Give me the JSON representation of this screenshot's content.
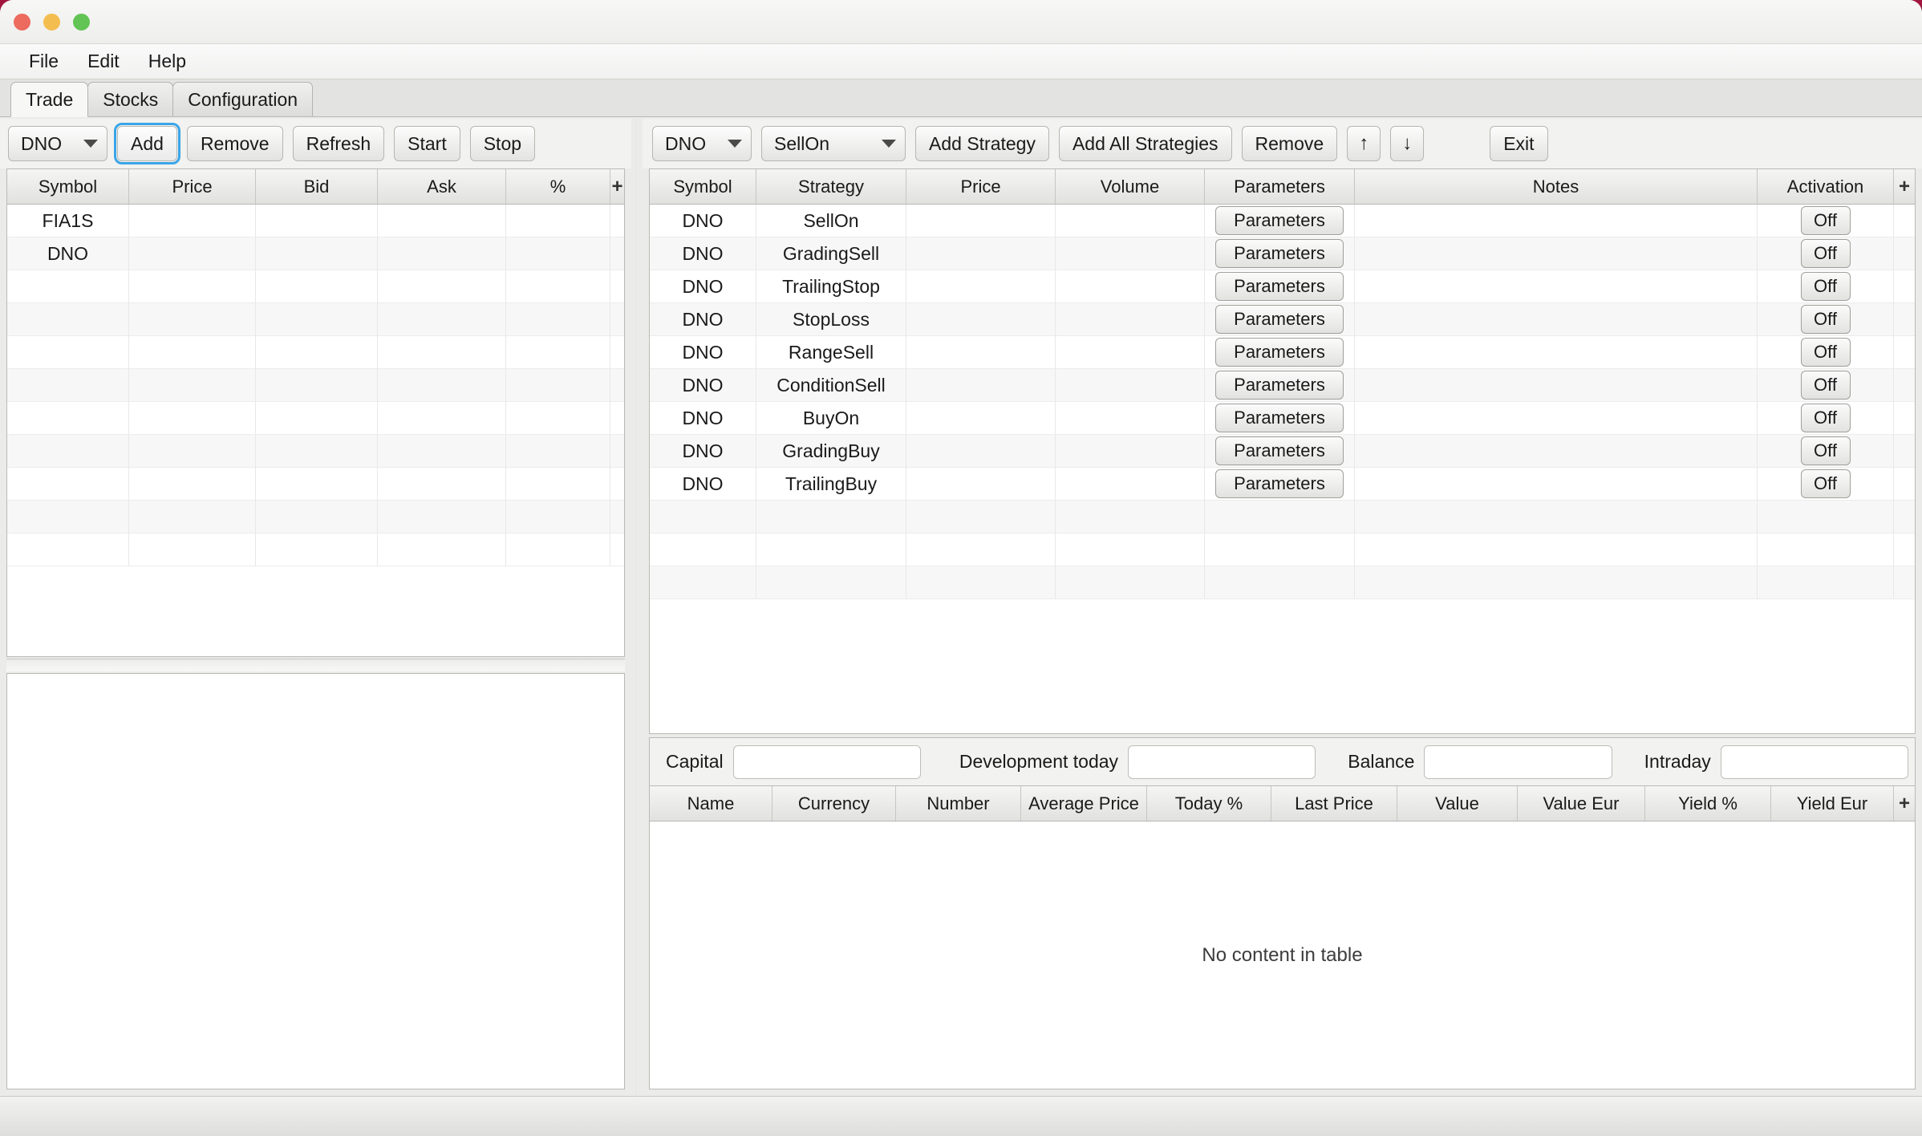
{
  "window": {
    "traffic_lights": [
      "close",
      "minimize",
      "maximize"
    ]
  },
  "menubar": {
    "items": [
      {
        "label": "File"
      },
      {
        "label": "Edit"
      },
      {
        "label": "Help"
      }
    ]
  },
  "tabs": [
    {
      "label": "Trade",
      "active": true
    },
    {
      "label": "Stocks",
      "active": false
    },
    {
      "label": "Configuration",
      "active": false
    }
  ],
  "left_panel": {
    "toolbar": {
      "symbol_combo": {
        "value": "DNO"
      },
      "add_button": {
        "label": "Add",
        "focused": true
      },
      "remove_button": {
        "label": "Remove"
      },
      "refresh_button": {
        "label": "Refresh"
      },
      "start_button": {
        "label": "Start"
      },
      "stop_button": {
        "label": "Stop"
      }
    },
    "table": {
      "columns": [
        "Symbol",
        "Price",
        "Bid",
        "Ask",
        "%",
        "+"
      ],
      "rows": [
        {
          "Symbol": "FIA1S",
          "Price": "",
          "Bid": "",
          "Ask": "",
          "%": ""
        },
        {
          "Symbol": "DNO",
          "Price": "",
          "Bid": "",
          "Ask": "",
          "%": ""
        },
        {
          "Symbol": "",
          "Price": "",
          "Bid": "",
          "Ask": "",
          "%": ""
        },
        {
          "Symbol": "",
          "Price": "",
          "Bid": "",
          "Ask": "",
          "%": ""
        },
        {
          "Symbol": "",
          "Price": "",
          "Bid": "",
          "Ask": "",
          "%": ""
        },
        {
          "Symbol": "",
          "Price": "",
          "Bid": "",
          "Ask": "",
          "%": ""
        },
        {
          "Symbol": "",
          "Price": "",
          "Bid": "",
          "Ask": "",
          "%": ""
        },
        {
          "Symbol": "",
          "Price": "",
          "Bid": "",
          "Ask": "",
          "%": ""
        },
        {
          "Symbol": "",
          "Price": "",
          "Bid": "",
          "Ask": "",
          "%": ""
        },
        {
          "Symbol": "",
          "Price": "",
          "Bid": "",
          "Ask": "",
          "%": ""
        },
        {
          "Symbol": "",
          "Price": "",
          "Bid": "",
          "Ask": "",
          "%": ""
        }
      ]
    },
    "log_pane": {
      "content": ""
    }
  },
  "right_panel": {
    "toolbar": {
      "symbol_combo": {
        "value": "DNO"
      },
      "strategy_combo": {
        "value": "SellOn"
      },
      "add_strategy_button": {
        "label": "Add Strategy"
      },
      "add_all_strategies_button": {
        "label": "Add All Strategies"
      },
      "remove_button": {
        "label": "Remove"
      },
      "move_up_button": {
        "label": "↑"
      },
      "move_down_button": {
        "label": "↓"
      },
      "exit_button": {
        "label": "Exit"
      }
    },
    "strategy_table": {
      "columns": [
        "Symbol",
        "Strategy",
        "Price",
        "Volume",
        "Parameters",
        "Notes",
        "Activation",
        "+"
      ],
      "parameters_button_label": "Parameters",
      "activation_button_label": "Off",
      "rows": [
        {
          "symbol": "DNO",
          "strategy": "SellOn",
          "price": "",
          "volume": "",
          "notes": "",
          "activation": "Off"
        },
        {
          "symbol": "DNO",
          "strategy": "GradingSell",
          "price": "",
          "volume": "",
          "notes": "",
          "activation": "Off"
        },
        {
          "symbol": "DNO",
          "strategy": "TrailingStop",
          "price": "",
          "volume": "",
          "notes": "",
          "activation": "Off"
        },
        {
          "symbol": "DNO",
          "strategy": "StopLoss",
          "price": "",
          "volume": "",
          "notes": "",
          "activation": "Off"
        },
        {
          "symbol": "DNO",
          "strategy": "RangeSell",
          "price": "",
          "volume": "",
          "notes": "",
          "activation": "Off"
        },
        {
          "symbol": "DNO",
          "strategy": "ConditionSell",
          "price": "",
          "volume": "",
          "notes": "",
          "activation": "Off"
        },
        {
          "symbol": "DNO",
          "strategy": "BuyOn",
          "price": "",
          "volume": "",
          "notes": "",
          "activation": "Off"
        },
        {
          "symbol": "DNO",
          "strategy": "GradingBuy",
          "price": "",
          "volume": "",
          "notes": "",
          "activation": "Off"
        },
        {
          "symbol": "DNO",
          "strategy": "TrailingBuy",
          "price": "",
          "volume": "",
          "notes": "",
          "activation": "Off"
        }
      ],
      "empty_rows": 3
    },
    "summary": {
      "capital": {
        "label": "Capital",
        "value": ""
      },
      "development_today": {
        "label": "Development today",
        "value": ""
      },
      "balance": {
        "label": "Balance",
        "value": ""
      },
      "intraday": {
        "label": "Intraday",
        "value": ""
      }
    },
    "portfolio_table": {
      "columns": [
        "Name",
        "Currency",
        "Number",
        "Average Price",
        "Today %",
        "Last Price",
        "Value",
        "Value Eur",
        "Yield %",
        "Yield Eur",
        "+"
      ],
      "empty_message": "No content in table"
    }
  },
  "colors": {
    "focus_ring": "#3aa5e8",
    "window_bg": "#f0f0ee",
    "header_gradient_top": "#f5f5f3",
    "header_gradient_bottom": "#e1e1df",
    "row_odd": "#ffffff",
    "row_even": "#f7f7f7",
    "traffic_red": "#ec6a5e",
    "traffic_yellow": "#f4bd4f",
    "traffic_green": "#61c454"
  }
}
